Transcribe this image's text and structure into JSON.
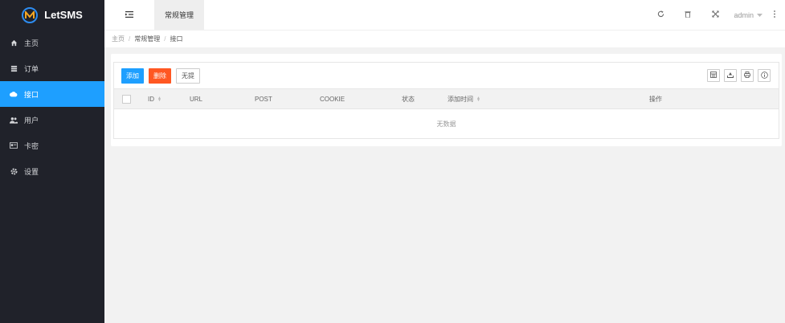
{
  "app": {
    "logo_text": "LetSMS"
  },
  "sidebar": {
    "items": [
      {
        "label": "主页",
        "icon": "home-icon"
      },
      {
        "label": "订单",
        "icon": "list-icon"
      },
      {
        "label": "接口",
        "icon": "cloud-icon",
        "active": true
      },
      {
        "label": "用户",
        "icon": "users-icon"
      },
      {
        "label": "卡密",
        "icon": "card-icon"
      },
      {
        "label": "设置",
        "icon": "gear-icon"
      }
    ]
  },
  "header": {
    "tab_label": "常规管理",
    "user_label": "admin"
  },
  "breadcrumb": {
    "items": [
      "主页",
      "常规管理",
      "接口"
    ]
  },
  "toolbar": {
    "add_label": "添加",
    "delete_label": "删除",
    "none_label": "无提"
  },
  "table": {
    "columns": [
      "ID",
      "URL",
      "POST",
      "COOKIE",
      "状态",
      "添加时间",
      "操作"
    ],
    "empty_text": "无数据"
  },
  "colors": {
    "accent": "#1e9fff",
    "danger": "#ff5722",
    "sidebar_bg": "#20222a"
  }
}
